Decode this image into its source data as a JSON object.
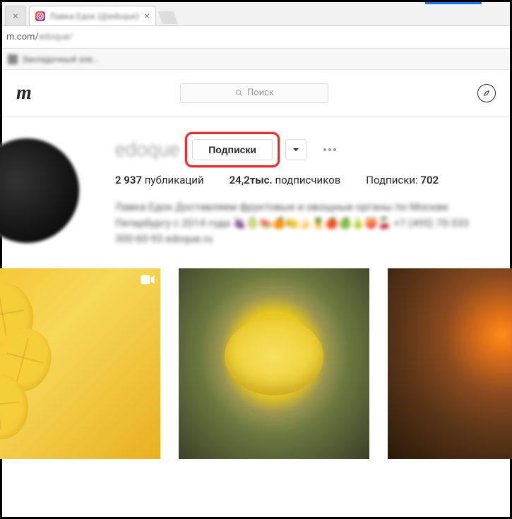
{
  "browser": {
    "tab_title": "Лавка Едок (@edoque)",
    "url_visible": "m.com/",
    "url_blur": "edoque/",
    "bookmark_label": "Закладочный эле..."
  },
  "header": {
    "logo_fragment": "m",
    "search_placeholder": "Поиск"
  },
  "profile": {
    "username": "edoque",
    "follow_button": "Подписки",
    "stats": {
      "posts_count": "2 937",
      "posts_label": "публикаций",
      "followers_count": "24,2тыс.",
      "followers_label": "подписчиков",
      "following_label": "Подписки:",
      "following_count": "702"
    },
    "bio_line1": "Лавка Едок Доставляем фруктовые и овощные органы по Москве",
    "bio_line2": "Петербургу с 2014 года 🍇🍈🍉🍊🍋🍌🍍🍎🍏🍐🍑🍒 +7 (495) 70-333",
    "bio_line3": "300-60-93 edoque.ru"
  }
}
